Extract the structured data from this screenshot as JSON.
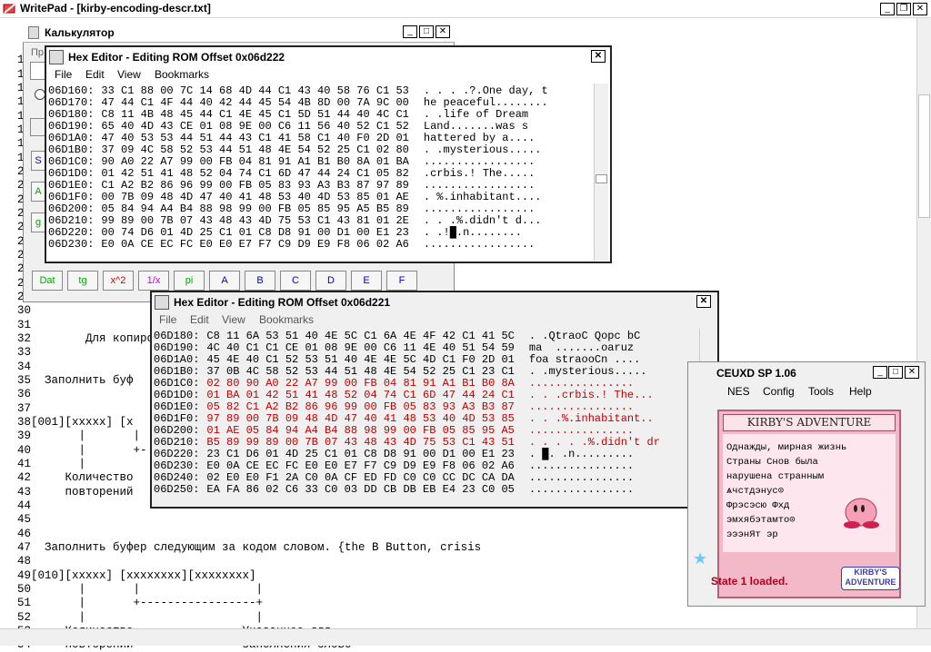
{
  "writepad": {
    "title": "WritePad - [kirby-encoding-descr.txt]",
    "menu_partial": "Фа",
    "lines": [
      {
        "n": "1",
        "t": ""
      },
      {
        "n": "12",
        "t": ""
      },
      {
        "n": "13",
        "t": ""
      },
      {
        "n": "14",
        "t": ""
      },
      {
        "n": "15",
        "t": ""
      },
      {
        "n": "16",
        "t": ""
      },
      {
        "n": "17",
        "t": ""
      },
      {
        "n": "18",
        "t": ""
      },
      {
        "n": "19",
        "t": ""
      },
      {
        "n": "20",
        "t": ""
      },
      {
        "n": "21",
        "t": ""
      },
      {
        "n": "22",
        "t": ""
      },
      {
        "n": "23",
        "t": ""
      },
      {
        "n": "24",
        "t": ""
      },
      {
        "n": "25",
        "t": ""
      },
      {
        "n": "26",
        "t": ""
      },
      {
        "n": "27",
        "t": ""
      },
      {
        "n": "28",
        "t": ""
      },
      {
        "n": "29",
        "t": ""
      },
      {
        "n": "30",
        "t": ""
      },
      {
        "n": "31",
        "t": ""
      },
      {
        "n": "32",
        "t": "        Для копиро"
      },
      {
        "n": "33",
        "t": ""
      },
      {
        "n": "34",
        "t": ""
      },
      {
        "n": "35",
        "t": "  Заполнить буф"
      },
      {
        "n": "36",
        "t": ""
      },
      {
        "n": "37",
        "t": ""
      },
      {
        "n": "38",
        "t": "[001][xxxxx] [x"
      },
      {
        "n": "39",
        "t": "       |       |"
      },
      {
        "n": "40",
        "t": "       |       +-"
      },
      {
        "n": "41",
        "t": "       |"
      },
      {
        "n": "42",
        "t": "     Количество"
      },
      {
        "n": "43",
        "t": "     повторений"
      },
      {
        "n": "44",
        "t": ""
      },
      {
        "n": "45",
        "t": ""
      },
      {
        "n": "46",
        "t": ""
      },
      {
        "n": "47",
        "t": "  Заполнить буфер следующим за кодом словом. {the B Button, crisis"
      },
      {
        "n": "48",
        "t": ""
      },
      {
        "n": "49",
        "t": "[010][xxxxx] [xxxxxxxx][xxxxxxxx]"
      },
      {
        "n": "50",
        "t": "       |       |                 |"
      },
      {
        "n": "51",
        "t": "       |       +-----------------+"
      },
      {
        "n": "52",
        "t": "       |                         |"
      },
      {
        "n": "53",
        "t": "     Количество                Указанное для"
      },
      {
        "n": "54",
        "t": "     повторений                заполнения слово"
      }
    ]
  },
  "calculator": {
    "title": "Калькулятор",
    "partial_label": "Пр",
    "buttons": [
      "Dat",
      "tg",
      "x^2",
      "1/x",
      "pi",
      "A",
      "B",
      "C",
      "D",
      "E",
      "F"
    ],
    "side_labels": [
      "S",
      "A",
      "g"
    ]
  },
  "hex1": {
    "title": "Hex Editor - Editing ROM Offset 0x06d222",
    "menu": [
      "File",
      "Edit",
      "View",
      "Bookmarks"
    ],
    "rows": [
      {
        "a": "06D160:",
        "h": "33 C1 88 00 7C 14 68 4D 44 C1 43 40 58 76 C1 53",
        "s": ". . . .?.One day, t"
      },
      {
        "a": "06D170:",
        "h": "47 44 C1 4F 44 40 42 44 45 54 4B 8D 00 7A 9C 00",
        "s": "he peaceful........"
      },
      {
        "a": "06D180:",
        "h": "C8 11 4B 48 45 44 C1 4E 45 C1 5D 51 44 40 4C C1",
        "s": ". .life of Dream "
      },
      {
        "a": "06D190:",
        "h": "65 40 4D 43 CE 01 08 9E 00 C6 11 56 40 52 C1 52",
        "s": "Land.......was s"
      },
      {
        "a": "06D1A0:",
        "h": "47 40 53 53 44 51 44 43 C1 41 58 C1 40 F0 2D 01",
        "s": "hattered by a...."
      },
      {
        "a": "06D1B0:",
        "h": "37 09 4C 58 52 53 44 51 48 4E 54 52 25 C1 02 80",
        "s": ". .mysterious....."
      },
      {
        "a": "06D1C0:",
        "h": "90 A0 22 A7 99 00 FB 04 81 91 A1 B1 B0 8A 01 BA",
        "s": "................."
      },
      {
        "a": "06D1D0:",
        "h": "01 42 51 41 48 52 04 74 C1 6D 47 44 24 C1 05 82",
        "s": ".crbis.! The....."
      },
      {
        "a": "06D1E0:",
        "h": "C1 A2 B2 86 96 99 00 FB 05 83 93 A3 B3 87 97 89",
        "s": "................."
      },
      {
        "a": "06D1F0:",
        "h": "00 7B 09 48 4D 47 40 41 48 53 40 4D 53 85 01 AE",
        "s": ". %.inhabitant...."
      },
      {
        "a": "06D200:",
        "h": "05 84 94 A4 B4 88 98 99 00 FB 05 85 95 A5 B5 89",
        "s": "................."
      },
      {
        "a": "06D210:",
        "h": "99 89 00 7B 07 43 48 43 4D 75 53 C1 43 81 01 2E",
        "s": ". . .%.didn't d..."
      },
      {
        "a": "06D220:",
        "h": "00 74 D6 01 4D 25 C1 01 C8 D8 91 00 D1 00 E1 23",
        "s": ". .!█.n........"
      },
      {
        "a": "06D230:",
        "h": "E0 0A CE EC FC E0 E0 E7 F7 C9 D9 E9 F8 06 02 A6",
        "s": "................."
      }
    ]
  },
  "hex2": {
    "title": "Hex Editor - Editing ROM Offset 0x06d221",
    "menu": [
      "File",
      "Edit",
      "View",
      "Bookmarks"
    ],
    "rows": [
      {
        "a": "06D180:",
        "h": "C8 11 6A 53 51 40 4E 5C C1 6A 4E 4F 42 C1 41 5C",
        "s": ". .QtraoC Qopc bC",
        "r": false
      },
      {
        "a": "06D190:",
        "h": "4C 40 C1 C1 CE 01 08 9E 00 C6 11 4E 40 51 54 59",
        "s": "ma  .......oaruz",
        "r": false
      },
      {
        "a": "06D1A0:",
        "h": "45 4E 40 C1 52 53 51 40 4E 4E 5C 4D C1 F0 2D 01",
        "s": "foa straooCn ....",
        "r": false
      },
      {
        "a": "06D1B0:",
        "h": "37 0B 4C 58 52 53 44 51 48 4E 54 52 25 C1 23 C1",
        "s": ". .mysterious.....",
        "r": false
      },
      {
        "a": "06D1C0:",
        "h": "02 80 90 A0 22 A7 99 00 FB 04 81 91 A1 B1 B0 8A",
        "s": "................",
        "r": true
      },
      {
        "a": "06D1D0:",
        "h": "01 BA 01 42 51 41 48 52 04 74 C1 6D 47 44 24 C1",
        "s": ". . .crbis.! The...",
        "r": true
      },
      {
        "a": "06D1E0:",
        "h": "05 82 C1 A2 B2 86 96 99 00 FB 05 83 93 A3 B3 87",
        "s": "................",
        "r": true
      },
      {
        "a": "06D1F0:",
        "h": "97 89 00 7B 09 48 4D 47 40 41 48 53 40 4D 53 85",
        "s": ". . .%.inhabitant..",
        "r": true
      },
      {
        "a": "06D200:",
        "h": "01 AE 05 84 94 A4 B4 88 98 99 00 FB 05 85 95 A5",
        "s": "................",
        "r": true
      },
      {
        "a": "06D210:",
        "h": "B5 89 99 89 00 7B 07 43 48 43 4D 75 53 C1 43 51",
        "s": ". . . . .%.didn't dr",
        "r": true
      },
      {
        "a": "06D220:",
        "h": "23 C1 D6 01 4D 25 C1 01 C8 D8 91 00 D1 00 E1 23",
        "s": ". █. .n.........",
        "r": false
      },
      {
        "a": "06D230:",
        "h": "E0 0A CE EC FC E0 E0 E7 F7 C9 D9 E9 F8 06 02 A6",
        "s": "................",
        "r": false
      },
      {
        "a": "06D240:",
        "h": "02 E0 E0 F1 2A C0 0A CF ED FD C0 C0 CC DC CA DA",
        "s": "................",
        "r": false
      },
      {
        "a": "06D250:",
        "h": "EA FA 86 02 C6 33 C0 03 DD CB DB EB E4 23 C0 05",
        "s": "................",
        "r": false
      }
    ]
  },
  "fceux": {
    "title": "CEUXD SP 1.06",
    "menu": [
      "NES",
      "Config",
      "Tools",
      "Help"
    ],
    "game_title": "KIRBY'S ADVENTURE",
    "game_lines": [
      "Однажды, мирная жизнь",
      "Страны Снов была",
      "нарушена странным",
      "ѧчстдэнус⊙",
      "Фрэсэсю Фхд",
      "эмхябэтамто⊙",
      "эээнЯт эр"
    ],
    "status": "State 1 loaded.",
    "logo": "KIRBY'S ADVENTURE"
  },
  "colors": {
    "red_text": "#c00000",
    "game_bg": "#f4b9c8"
  }
}
